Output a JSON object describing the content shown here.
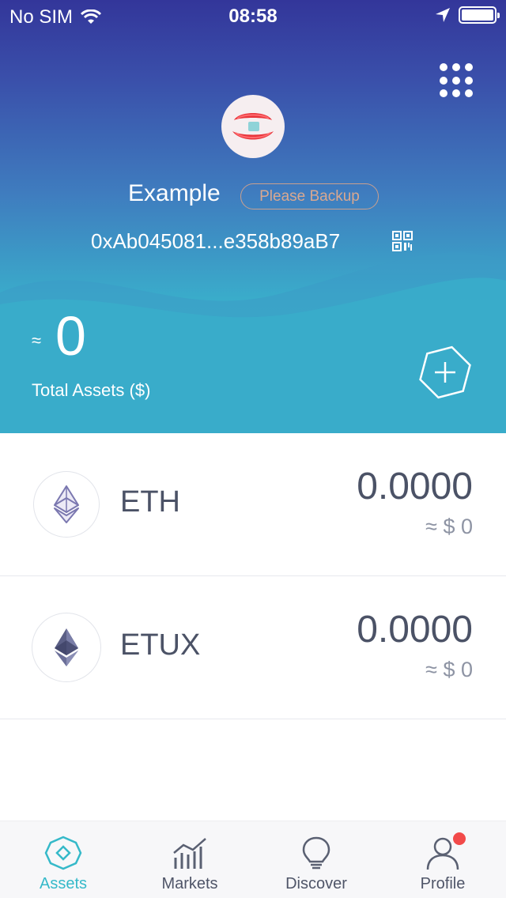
{
  "status_bar": {
    "carrier": "No SIM",
    "time": "08:58"
  },
  "wallet": {
    "name": "Example",
    "backup_label": "Please Backup",
    "address": "0xAb045081...e358b89aB7"
  },
  "total": {
    "approx_symbol": "≈",
    "value": "0",
    "label": "Total Assets ($)"
  },
  "assets": [
    {
      "symbol": "ETH",
      "balance": "0.0000",
      "fiat": "≈ $ 0",
      "icon": "ethereum-outline-icon"
    },
    {
      "symbol": "ETUX",
      "balance": "0.0000",
      "fiat": "≈ $ 0",
      "icon": "ethereum-filled-icon"
    }
  ],
  "tabs": [
    {
      "label": "Assets",
      "icon": "assets-icon",
      "active": true
    },
    {
      "label": "Markets",
      "icon": "markets-icon",
      "active": false
    },
    {
      "label": "Discover",
      "icon": "lightbulb-icon",
      "active": false
    },
    {
      "label": "Profile",
      "icon": "profile-icon",
      "active": false,
      "badge": true
    }
  ],
  "colors": {
    "accent": "#35b9c9",
    "header_top": "#33369a",
    "header_bottom": "#38b7cb",
    "badge": "#f24a4a"
  }
}
